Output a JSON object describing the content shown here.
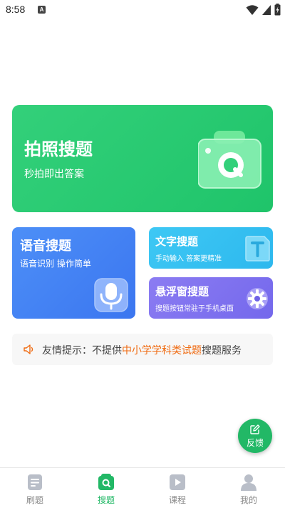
{
  "status_bar": {
    "time": "8:58",
    "notification_letter": "A"
  },
  "photo_card": {
    "title": "拍照搜题",
    "subtitle": "秒拍即出答案"
  },
  "voice_card": {
    "title": "语音搜题",
    "subtitle": "语音识别 操作简单"
  },
  "text_card": {
    "title": "文字搜题",
    "subtitle": "手动输入 答案更精准",
    "icon_letter": "T"
  },
  "float_card": {
    "title": "悬浮窗搜题",
    "subtitle": "搜题按钮常驻于手机桌面"
  },
  "notice": {
    "prefix": "友情提示：不提供",
    "highlight": "中小学学科类试题",
    "suffix": "搜题服务",
    "highlight_color": "#f06a10"
  },
  "feedback": {
    "label": "反馈"
  },
  "bottom_nav": {
    "items": [
      {
        "label": "刷题",
        "icon": "document-icon",
        "active": false
      },
      {
        "label": "搜题",
        "icon": "search-icon",
        "active": true
      },
      {
        "label": "课程",
        "icon": "play-icon",
        "active": false
      },
      {
        "label": "我的",
        "icon": "user-icon",
        "active": false
      }
    ]
  },
  "colors": {
    "green": "#22b866",
    "blue": "#3b76f0",
    "cyan": "#2db8ee",
    "purple": "#7468ec"
  }
}
